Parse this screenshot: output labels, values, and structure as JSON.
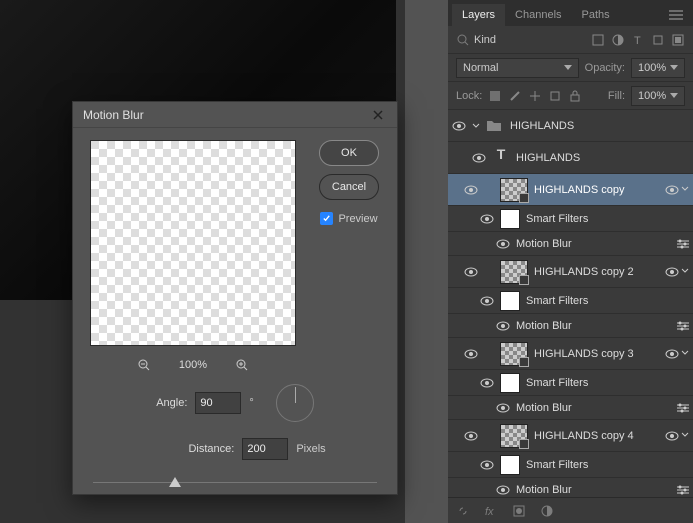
{
  "dialog": {
    "title": "Motion Blur",
    "ok": "OK",
    "cancel": "Cancel",
    "preview_label": "Preview",
    "zoom": "100%",
    "angle_label": "Angle:",
    "angle_value": "90",
    "angle_unit": "°",
    "distance_label": "Distance:",
    "distance_value": "200",
    "distance_unit": "Pixels"
  },
  "panel": {
    "tabs": [
      "Layers",
      "Channels",
      "Paths"
    ],
    "filter_placeholder": "Kind",
    "blend_mode": "Normal",
    "opacity_label": "Opacity:",
    "opacity_value": "100%",
    "lock_label": "Lock:",
    "fill_label": "Fill:",
    "fill_value": "100%"
  },
  "layers": [
    {
      "type": "group",
      "name": "HIGHLANDS"
    },
    {
      "type": "text",
      "name": "HIGHLANDS"
    },
    {
      "type": "smart",
      "name": "HIGHLANDS copy",
      "selected": true,
      "filters": [
        {
          "name": "Smart Filters"
        },
        {
          "name": "Motion Blur"
        }
      ]
    },
    {
      "type": "smart",
      "name": "HIGHLANDS copy 2",
      "filters": [
        {
          "name": "Smart Filters"
        },
        {
          "name": "Motion Blur"
        }
      ]
    },
    {
      "type": "smart",
      "name": "HIGHLANDS copy 3",
      "filters": [
        {
          "name": "Smart Filters"
        },
        {
          "name": "Motion Blur"
        }
      ]
    },
    {
      "type": "smart",
      "name": "HIGHLANDS copy 4",
      "filters": [
        {
          "name": "Smart Filters"
        },
        {
          "name": "Motion Blur"
        }
      ]
    }
  ]
}
